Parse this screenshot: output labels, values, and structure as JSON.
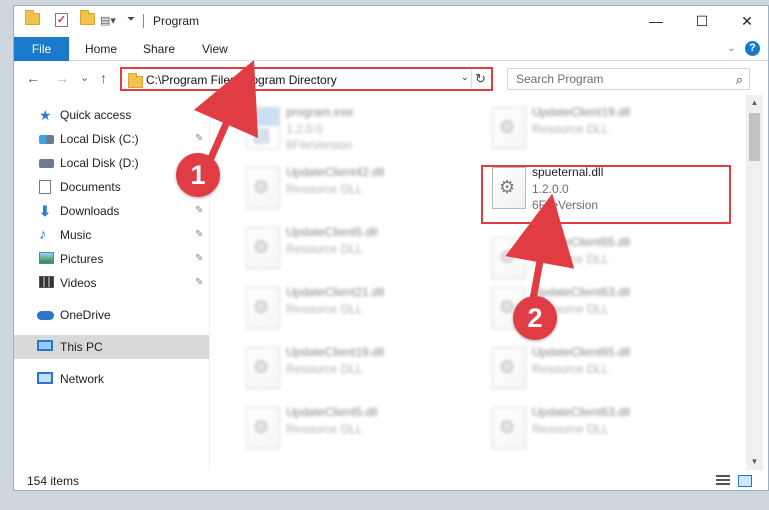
{
  "window": {
    "title": "Program",
    "buttons": {
      "minimize": "—",
      "maximize": "☐",
      "close": "✕"
    }
  },
  "ribbon": {
    "tabs": [
      "File",
      "Home",
      "Share",
      "View"
    ],
    "help_label": "?"
  },
  "nav": {
    "back": "←",
    "forward": "→",
    "recent": "⌄",
    "up": "↑",
    "address": "C:\\Program Files\\Program Directory",
    "refresh": "↻",
    "search_placeholder": "Search Program"
  },
  "sidebar": {
    "items": [
      {
        "label": "Quick access",
        "icon": "star-icon",
        "pinned": false
      },
      {
        "label": "Local Disk (C:)",
        "icon": "drive-icon",
        "pinned": true
      },
      {
        "label": "Local Disk (D:)",
        "icon": "drive-icon",
        "pinned": false
      },
      {
        "label": "Documents",
        "icon": "document-icon",
        "pinned": true
      },
      {
        "label": "Downloads",
        "icon": "download-icon",
        "pinned": true
      },
      {
        "label": "Music",
        "icon": "music-icon",
        "pinned": true
      },
      {
        "label": "Pictures",
        "icon": "pictures-icon",
        "pinned": true
      },
      {
        "label": "Videos",
        "icon": "videos-icon",
        "pinned": true
      },
      {
        "label": "OneDrive",
        "icon": "onedrive-icon",
        "pinned": false
      },
      {
        "label": "This PC",
        "icon": "this-pc-icon",
        "pinned": false,
        "selected": true
      },
      {
        "label": "Network",
        "icon": "network-icon",
        "pinned": false
      }
    ],
    "pin_glyph": "📌"
  },
  "files": [
    {
      "name": "program.exe",
      "line1": "1.2.0.0",
      "line2": "6FileVersion",
      "type": "exe",
      "blurred": true
    },
    {
      "name": "UpdateClient19.dll",
      "line1": "Resource DLL",
      "line2": "",
      "type": "dll",
      "blurred": true
    },
    {
      "name": "UpdateClient42.dll",
      "line1": "Resource DLL",
      "line2": "",
      "type": "dll",
      "blurred": true
    },
    {
      "name": "spueternal.dll",
      "line1": "1.2.0.0",
      "line2": "6FileVersion",
      "type": "dll",
      "blurred": false,
      "highlighted": true
    },
    {
      "name": "UpdateClient5.dll",
      "line1": "Resource DLL",
      "line2": "",
      "type": "dll",
      "blurred": true
    },
    {
      "name": "UpdateClient65.dll",
      "line1": "Resource DLL",
      "line2": "",
      "type": "dll",
      "blurred": true
    },
    {
      "name": "UpdateClient21.dll",
      "line1": "Resource DLL",
      "line2": "",
      "type": "dll",
      "blurred": true
    },
    {
      "name": "UpdateClient63.dll",
      "line1": "Resource DLL",
      "line2": "",
      "type": "dll",
      "blurred": true
    },
    {
      "name": "UpdateClient19.dll",
      "line1": "Resource DLL",
      "line2": "",
      "type": "dll",
      "blurred": true
    },
    {
      "name": "UpdateClient65.dll",
      "line1": "Resource DLL",
      "line2": "",
      "type": "dll",
      "blurred": true
    },
    {
      "name": "UpdateClient5.dll",
      "line1": "Resource DLL",
      "line2": "",
      "type": "dll",
      "blurred": true
    },
    {
      "name": "UpdateClient63.dll",
      "line1": "Resource DLL",
      "line2": "",
      "type": "dll",
      "blurred": true
    }
  ],
  "status": {
    "item_count": "154 items"
  },
  "annotations": {
    "step1": "1",
    "step2": "2",
    "color": "#e03c43"
  },
  "colors": {
    "accent": "#1979ca",
    "highlight": "#e03c43",
    "selected_bg": "#d9d9d9"
  }
}
